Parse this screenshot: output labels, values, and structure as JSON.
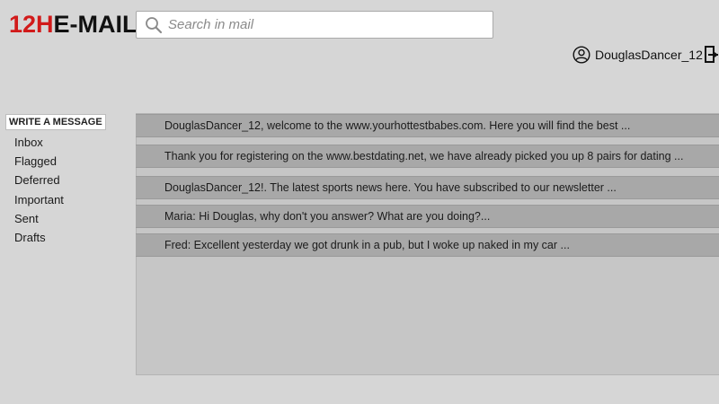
{
  "logo": {
    "part1": "12H",
    "part2": "E-MAIL"
  },
  "search": {
    "placeholder": "Search in mail"
  },
  "user": {
    "name": "DouglasDancer_12"
  },
  "sidebar": {
    "compose_label": "WRITE A MESSAGE",
    "folders": [
      "Inbox",
      "Flagged",
      "Deferred",
      "Important",
      "Sent",
      "Drafts"
    ]
  },
  "mails": [
    "DouglasDancer_12, welcome to the www.yourhottestbabes.com. Here you will find the best ...",
    "Thank you for registering on the www.bestdating.net, we have already picked you up 8 pairs for dating ...",
    "DouglasDancer_12!. The latest sports news here. You have subscribed to our newsletter ...",
    "Maria: Hi Douglas, why don't you answer? What are you doing?...",
    "Fred: Excellent yesterday we got drunk in a pub, but I woke up naked in my car ..."
  ],
  "colors": {
    "logo_accent": "#d11a1a",
    "background": "#d6d6d6",
    "mail_row": "#a8a8a8"
  }
}
